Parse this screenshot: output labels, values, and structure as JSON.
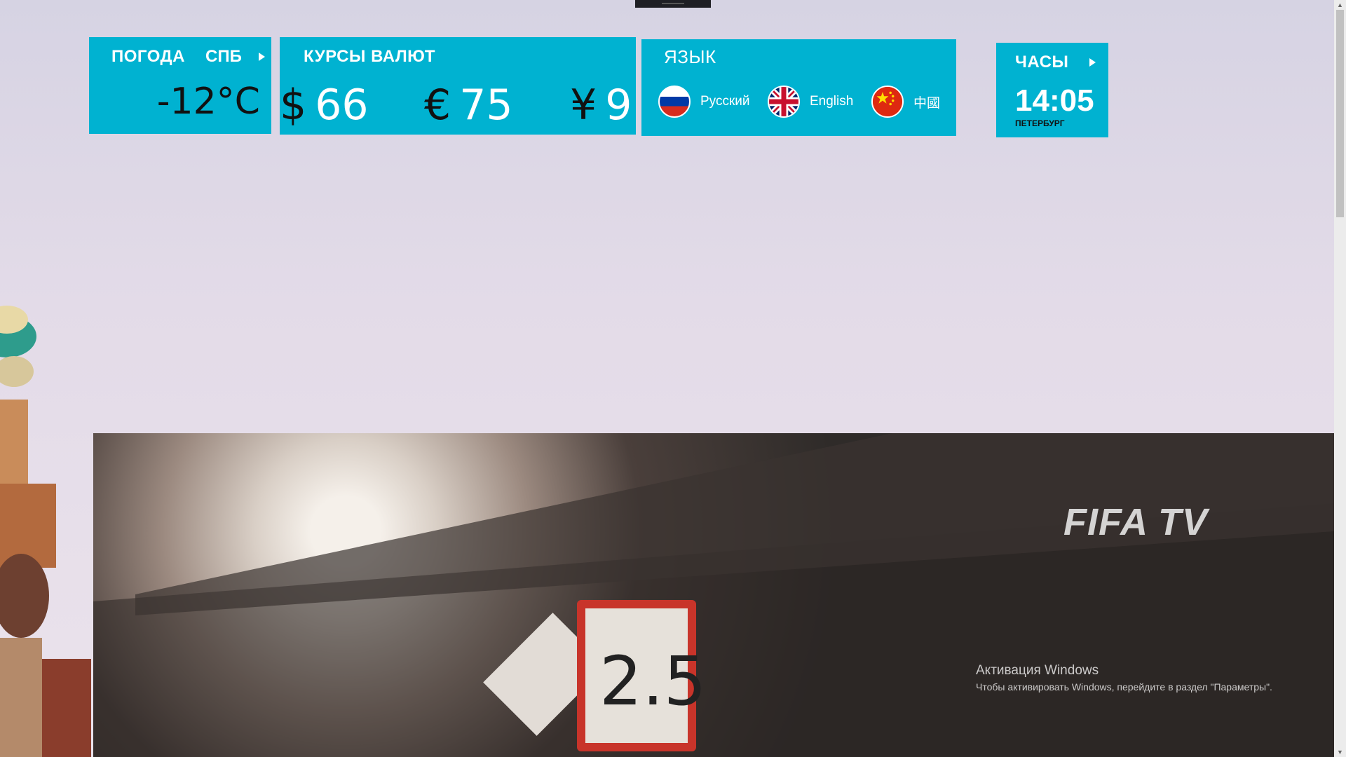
{
  "weather": {
    "title": "ПОГОДА",
    "city": "СПБ",
    "temperature": "-12°C"
  },
  "currency": {
    "title": "КУРСЫ ВАЛЮТ",
    "rates": [
      {
        "symbol": "$",
        "value": "66"
      },
      {
        "symbol": "€",
        "value": "75"
      },
      {
        "symbol": "¥",
        "value": "9"
      }
    ]
  },
  "language": {
    "title": "ЯЗЫК",
    "options": [
      {
        "label": "Русский",
        "flag": "russia-flag-icon"
      },
      {
        "label": "English",
        "flag": "uk-flag-icon"
      },
      {
        "label": "中國",
        "flag": "china-flag-icon"
      }
    ]
  },
  "clock": {
    "title": "ЧАСЫ",
    "time": "14:05",
    "city": "ПЕТЕРБУРГ"
  },
  "video": {
    "watermark": "FIFA TV",
    "sign_text": "2.5"
  },
  "system": {
    "activation_title": "Активация Windows",
    "activation_text": "Чтобы активировать Windows, перейдите в раздел \"Параметры\"."
  },
  "colors": {
    "panel": "#00b2d1",
    "dark_text": "#111111"
  }
}
